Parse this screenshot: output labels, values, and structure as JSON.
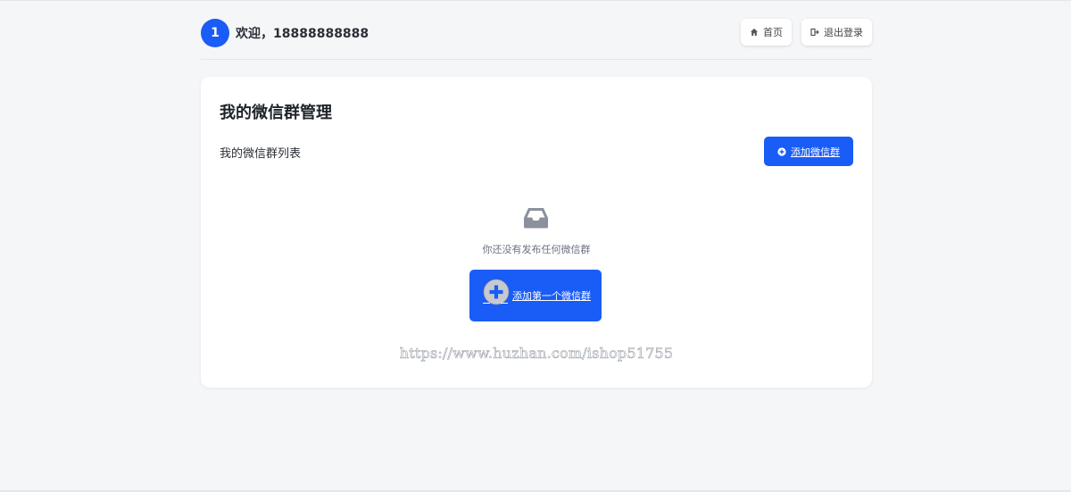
{
  "header": {
    "avatar_text": "1",
    "welcome_text": "欢迎，18888888888",
    "home_label": "首页",
    "logout_label": "退出登录"
  },
  "card": {
    "title": "我的微信群管理",
    "list_label": "我的微信群列表",
    "add_button_label": "添加微信群",
    "empty_text": "你还没有发布任何微信群",
    "add_first_label": "添加第一个微信群"
  },
  "watermark": "https://www.huzhan.com/ishop51755",
  "colors": {
    "primary": "#1a5cf6",
    "background": "#f5f6f8",
    "icon_gray": "#8a919c"
  },
  "icons": {
    "home": "home-icon",
    "logout": "sign-out-icon",
    "add": "plus-circle-icon",
    "empty": "inbox-icon"
  }
}
